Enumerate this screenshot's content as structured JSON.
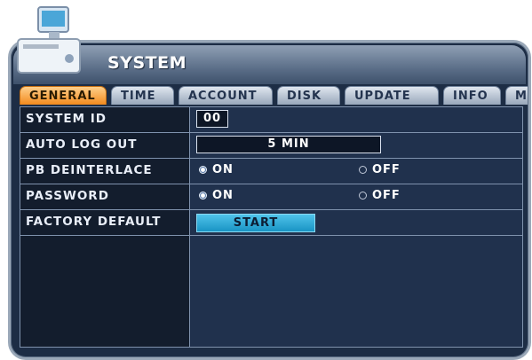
{
  "window": {
    "title": "SYSTEM",
    "icon": "computer-icon"
  },
  "tabs": [
    {
      "label": "GENERAL",
      "active": true
    },
    {
      "label": "TIME",
      "active": false
    },
    {
      "label": "ACCOUNT",
      "active": false
    },
    {
      "label": "DISK",
      "active": false
    },
    {
      "label": "UPDATE",
      "active": false
    },
    {
      "label": "INFO",
      "active": false
    },
    {
      "label": "M",
      "active": false
    }
  ],
  "settings": {
    "system_id": {
      "label": "SYSTEM ID",
      "value": "00"
    },
    "auto_log_out": {
      "label": "AUTO LOG OUT",
      "value": "5 MIN"
    },
    "pb_deinterlace": {
      "label": "PB DEINTERLACE",
      "on_label": "ON",
      "off_label": "OFF",
      "selected": "ON"
    },
    "password": {
      "label": "PASSWORD",
      "on_label": "ON",
      "off_label": "OFF",
      "selected": "ON"
    },
    "factory_default": {
      "label": "FACTORY DEFAULT",
      "button_label": "START"
    }
  },
  "colors": {
    "accent": "#f28a1e",
    "panel": "#20314d",
    "button": "#29a9d8"
  }
}
